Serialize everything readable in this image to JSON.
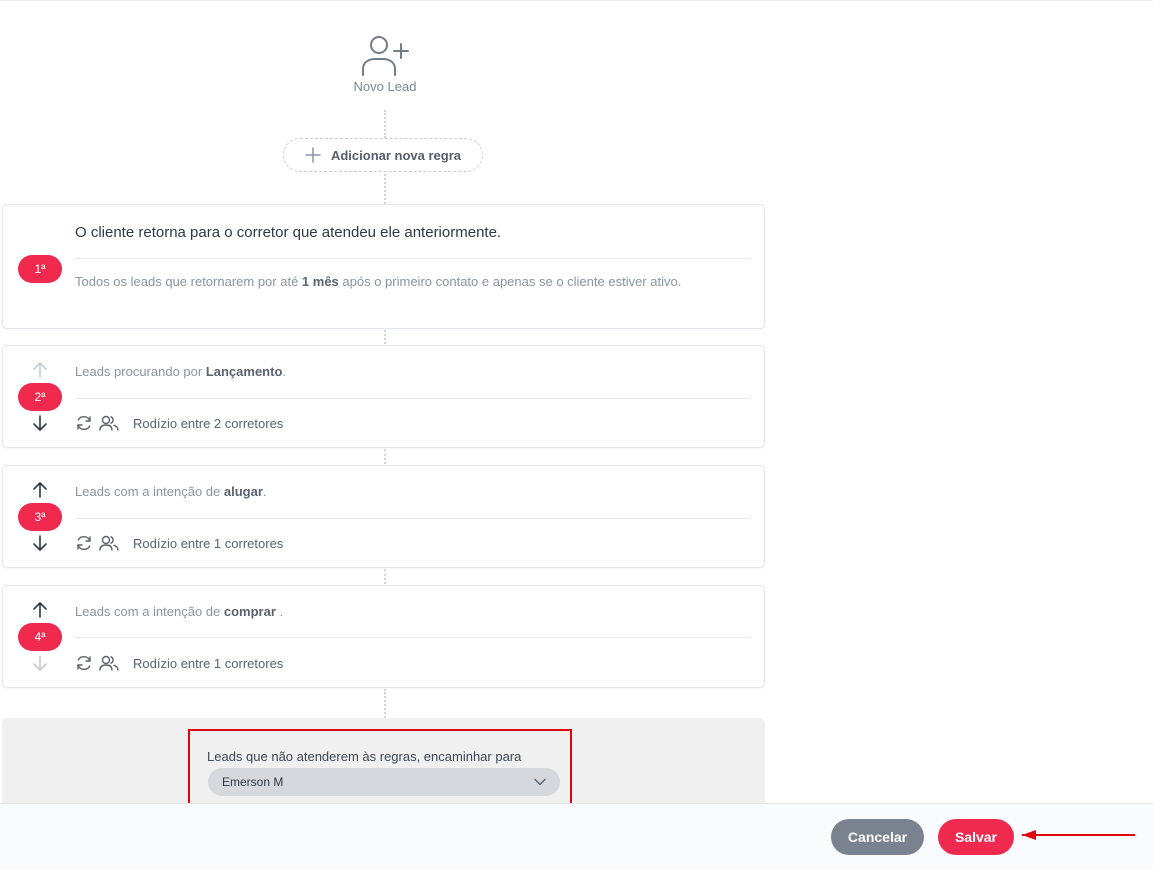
{
  "header": {
    "new_lead_label": "Novo Lead",
    "add_rule_label": "Adicionar nova regra"
  },
  "rules": [
    {
      "order": "1ª",
      "title": "O cliente retorna para o corretor que atendeu ele anteriormente.",
      "desc_before": "Todos os leads que retornarem por até ",
      "desc_bold": "1 mês",
      "desc_after": " após o primeiro contato e apenas se o cliente estiver ativo."
    },
    {
      "order": "2ª",
      "line_before": "Leads procurando por ",
      "line_bold": "Lançamento",
      "line_after": ".",
      "distribution": "Rodízio entre 2 corretores"
    },
    {
      "order": "3ª",
      "line_before": "Leads com a intenção de ",
      "line_bold": "alugar",
      "line_after": ".",
      "distribution": "Rodízio entre 1 corretores"
    },
    {
      "order": "4ª",
      "line_before": "Leads com a intenção de ",
      "line_bold": "comprar",
      "line_after": " .",
      "distribution": "Rodízio entre 1 corretores"
    }
  ],
  "fallback": {
    "label": "Leads que não atenderem às regras, encaminhar para",
    "selected": "Emerson M"
  },
  "footer": {
    "cancel_label": "Cancelar",
    "save_label": "Salvar"
  },
  "icons": [
    "user-plus-icon",
    "plus-icon",
    "arrow-up-icon",
    "arrow-down-icon",
    "refresh-icon",
    "users-icon",
    "chevron-down-icon",
    "red-arrow-icon"
  ],
  "colors": {
    "accent": "#f0294f",
    "cancel": "#7a8290",
    "highlight": "#e0040d"
  }
}
